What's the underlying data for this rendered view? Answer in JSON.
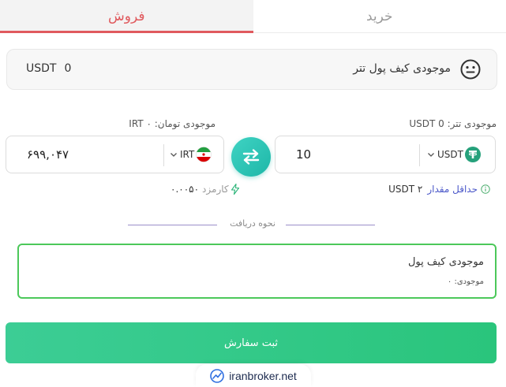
{
  "tabs": {
    "sell_label": "فروش",
    "buy_label": "خرید"
  },
  "wallet": {
    "label": "موجودی کیف پول تتر",
    "amount": "0",
    "currency": "USDT"
  },
  "usdt_field": {
    "balance_label": "موجودی تتر: 0 USDT",
    "value": "10",
    "currency": "USDT"
  },
  "irt_field": {
    "balance_label": "موجودی تومان: ۰ IRT",
    "value": "۶۹۹,۰۴۷",
    "currency": "IRT"
  },
  "minimum": {
    "label": "حداقل مقدار",
    "value": "USDT ۲"
  },
  "fee": {
    "label": "کارمزد",
    "value": "۰.۰۰۵۰"
  },
  "receive_method": {
    "separator_label": "نحوه دریافت",
    "title": "موجودی کیف پول",
    "balance": "موجودی: ۰"
  },
  "submit": {
    "label": "ثبت سفارش"
  },
  "watermark": {
    "text": "iranbroker.net"
  },
  "colors": {
    "sell_accent": "#e05a5e",
    "swap_button": "#1eb7a8",
    "method_border": "#4cc85a",
    "submit_button": "#2ac57c",
    "minimum_link": "#4a57c9"
  }
}
